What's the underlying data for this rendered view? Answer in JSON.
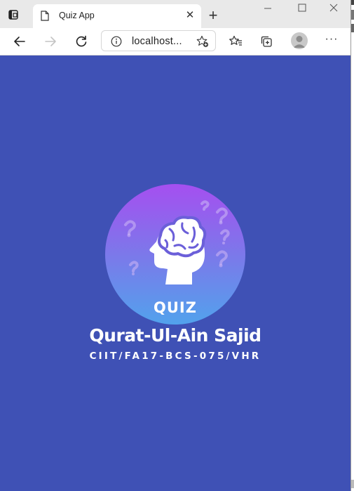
{
  "browser": {
    "tab_title": "Quiz App",
    "tab_close_glyph": "✕",
    "new_tab_glyph": "+",
    "address_url": "localhost...",
    "more_glyph": "···",
    "icons": {
      "tab_actions": "tab-actions-icon",
      "page": "document-icon",
      "back": "back-arrow-icon",
      "forward": "forward-arrow-icon",
      "refresh": "refresh-icon",
      "site_info": "info-icon",
      "add_favorite": "add-favorite-icon",
      "favorites": "favorites-icon",
      "collections": "collections-icon",
      "profile": "profile-avatar-icon"
    }
  },
  "page": {
    "background": "#3f51b5",
    "logo_text": "QUIZ",
    "name": "Qurat-Ul-Ain Sajid",
    "registration": "CIIT/FA17-BCS-075/VHR"
  }
}
